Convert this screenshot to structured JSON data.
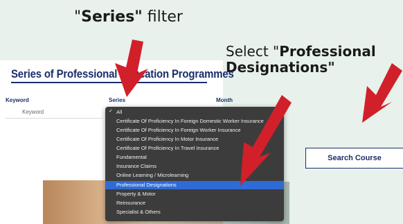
{
  "annotations": {
    "series_prefix": "\"",
    "series_bold": "Series\"",
    "series_suffix": " filter",
    "select_line1_prefix": "Select \"",
    "select_line1_bold": "Professional",
    "select_line2_bold": "Designations\""
  },
  "page": {
    "heading": "Series of Professional Education Programmes"
  },
  "filters": {
    "keyword_label": "Keyword",
    "keyword_placeholder": "Keyword",
    "series_label": "Series",
    "month_label": "Month"
  },
  "series_dropdown": {
    "checked_option": "All",
    "selected_option": "Professional Designations",
    "options": [
      "All",
      "Certificate Of Proficiency In Foreign Domestic Worker Insurance",
      "Certificate Of Proficiency In Foreign Worker Insurance",
      "Certificate Of Proficiency In Motor Insurance",
      "Certificate Of Proficiency In Travel Insurance",
      "Fundamental",
      "Insurance Claims",
      "Online Learning / Microlearning",
      "Professional Designations",
      "Property & Motor",
      "Reinsurance",
      "Specialist & Others"
    ]
  },
  "actions": {
    "search_label": "Search Course"
  },
  "colors": {
    "arrow": "#d1202a",
    "brand_navy": "#1a2e6b",
    "selection": "#2f6bd6"
  }
}
